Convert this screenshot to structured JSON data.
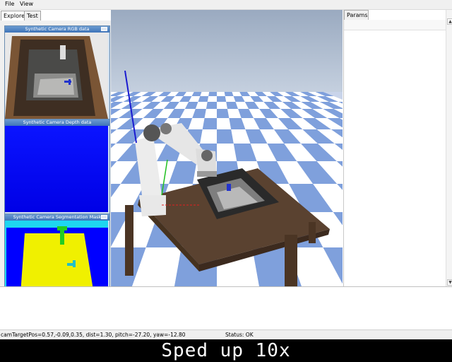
{
  "menu": {
    "file": "File",
    "view": "View"
  },
  "left_tabs": [
    {
      "label": "Explorer"
    },
    {
      "label": "Test"
    }
  ],
  "camera_windows": {
    "rgb": {
      "title": "Synthetic Camera RGB data"
    },
    "depth": {
      "title": "Synthetic Camera Depth data"
    },
    "segmentation": {
      "title": "Synthetic Camera Segmentation Mask"
    }
  },
  "right_panel": {
    "tab_label": "Params"
  },
  "status": {
    "camera": "camTargetPos=0.57,-0.09,0.35, dist=1.30, pitch=-27.20, yaw=-12.80",
    "state": "Status: OK"
  },
  "caption": "Sped up 10x",
  "colors": {
    "depth_blue": "#0000ff",
    "seg_background": "#1ed6f0",
    "seg_table": "#f0f000",
    "seg_robot": "#22cc22",
    "sky": "#b4c1d4",
    "floor_tile_light": "#ffffff",
    "floor_tile_blue": "#7fa0dc"
  },
  "icons": [
    "close-icon",
    "scroll-up-icon",
    "scroll-down-icon"
  ]
}
